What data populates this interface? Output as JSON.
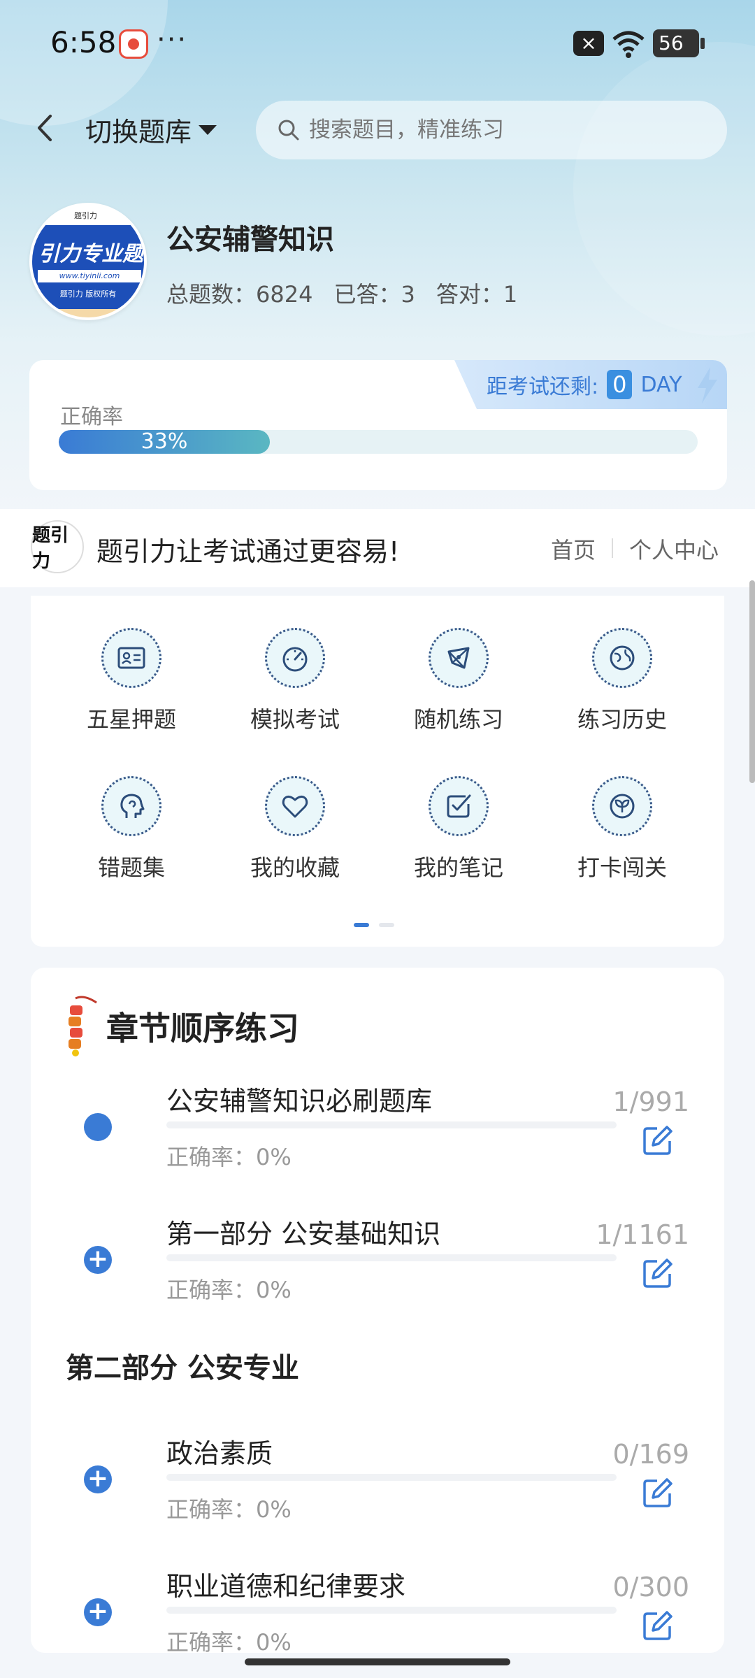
{
  "status_bar": {
    "time": "6:58",
    "dots": "···",
    "battery": "56"
  },
  "header": {
    "switch_label": "切换题库",
    "search_placeholder": "搜索题目，精准练习"
  },
  "bank": {
    "logo_text": "引力专业题",
    "logo_url": "www.tiyinli.com",
    "logo_copyright": "题引力 版权所有",
    "title": "公安辅警知识",
    "stats": {
      "total_label": "总题数：",
      "total": "6824",
      "answered_label": "已答：",
      "answered": "3",
      "correct_label": "答对：",
      "correct": "1"
    }
  },
  "accuracy": {
    "countdown_label": "距考试还剩:",
    "countdown_days": "0",
    "countdown_unit": "DAY",
    "label": "正确率",
    "value": 0.33,
    "text": "33%"
  },
  "promo": {
    "mark": "题引力",
    "slogan": "题引力让考试通过更容易!",
    "home_link": "首页",
    "profile_link": "个人中心"
  },
  "menu": {
    "items": [
      {
        "label": "五星押题",
        "icon": "id-card-icon"
      },
      {
        "label": "模拟考试",
        "icon": "gauge-icon"
      },
      {
        "label": "随机练习",
        "icon": "network-icon"
      },
      {
        "label": "练习历史",
        "icon": "globe-icon"
      },
      {
        "label": "错题集",
        "icon": "head-icon"
      },
      {
        "label": "我的收藏",
        "icon": "heart-icon"
      },
      {
        "label": "我的笔记",
        "icon": "note-check-icon"
      },
      {
        "label": "打卡闯关",
        "icon": "leaf-icon"
      }
    ],
    "pages": 2,
    "active_page": 1
  },
  "chapters": {
    "heading": "章节顺序练习",
    "section2_title": "第二部分 公安专业",
    "rows": [
      {
        "name": "公安辅警知识必刷题库",
        "rate": "正确率：0%",
        "count": "1/991",
        "marker": "dot"
      },
      {
        "name": "第一部分 公安基础知识",
        "rate": "正确率：0%",
        "count": "1/1161",
        "marker": "plus"
      },
      {
        "name": "政治素质",
        "rate": "正确率：0%",
        "count": "0/169",
        "marker": "plus"
      },
      {
        "name": "职业道德和纪律要求",
        "rate": "正确率：0%",
        "count": "0/300",
        "marker": "plus"
      }
    ]
  },
  "colors": {
    "accent": "#3a7bd5",
    "teal": "#5ab7c2"
  }
}
